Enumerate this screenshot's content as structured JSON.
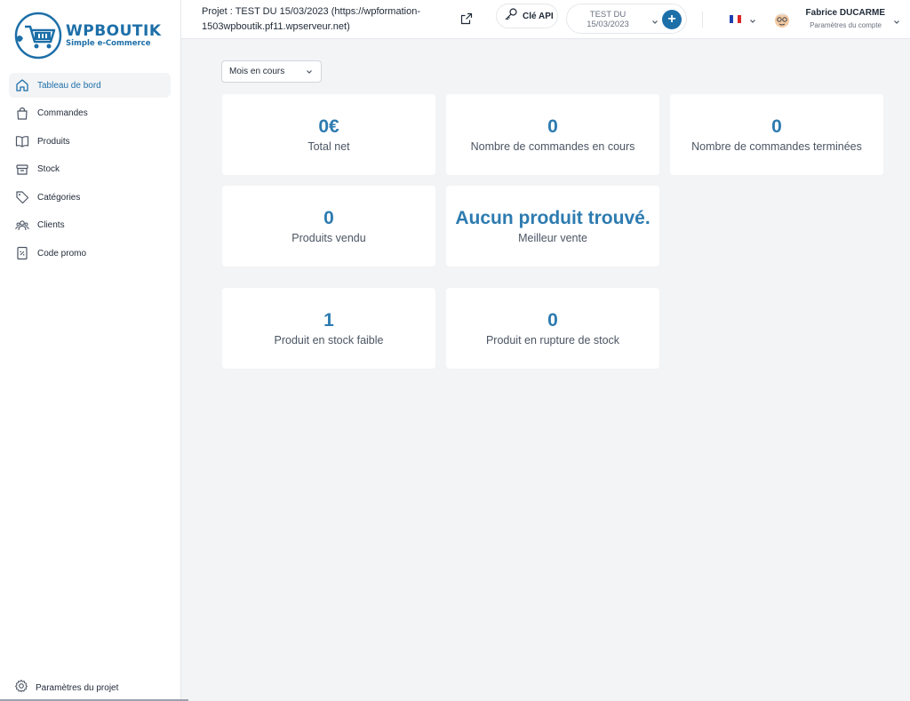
{
  "brand": {
    "title": "WPBOUTIK",
    "subtitle": "Simple e-Commerce",
    "color": "#1d6fa8"
  },
  "sidebar": {
    "items": [
      {
        "label": "Tableau de bord",
        "icon": "home-icon",
        "active": true
      },
      {
        "label": "Commandes",
        "icon": "shopping-bag-icon"
      },
      {
        "label": "Produits",
        "icon": "book-icon"
      },
      {
        "label": "Stock",
        "icon": "box-icon"
      },
      {
        "label": "Catégories",
        "icon": "tag-icon"
      },
      {
        "label": "Clients",
        "icon": "users-icon"
      },
      {
        "label": "Code promo",
        "icon": "coupon-icon"
      }
    ],
    "bottom": {
      "label": "Paramètres du projet",
      "icon": "gear-icon"
    }
  },
  "header": {
    "project_line1": "Projet : TEST DU 15/03/2023 (https://wpformation-",
    "project_line2": "1503wpboutik.pf11.wpserveur.net)",
    "api_label": "Clé API",
    "project_select_line1": "TEST DU",
    "project_select_line2": "15/03/2023",
    "add_label": "+",
    "language": "FR",
    "user_name": "Fabrice DUCARME",
    "user_sub": "Paramètres du compte"
  },
  "main": {
    "period": "Mois en cours",
    "cards": [
      {
        "value": "0€",
        "caption": "Total net"
      },
      {
        "value": "0",
        "caption": "Nombre de commandes en cours"
      },
      {
        "value": "0",
        "caption": "Nombre de commandes terminées"
      },
      {
        "value": "0",
        "caption": "Produits vendu"
      },
      {
        "value": "Aucun produit trouvé.",
        "caption": "Meilleur vente"
      },
      {
        "value": "1",
        "caption": "Produit en stock faible"
      },
      {
        "value": "0",
        "caption": "Produit en rupture de stock"
      }
    ]
  },
  "colors": {
    "accent": "#1d6fa8",
    "value": "#2d7bb0",
    "background": "#f3f4f6"
  }
}
